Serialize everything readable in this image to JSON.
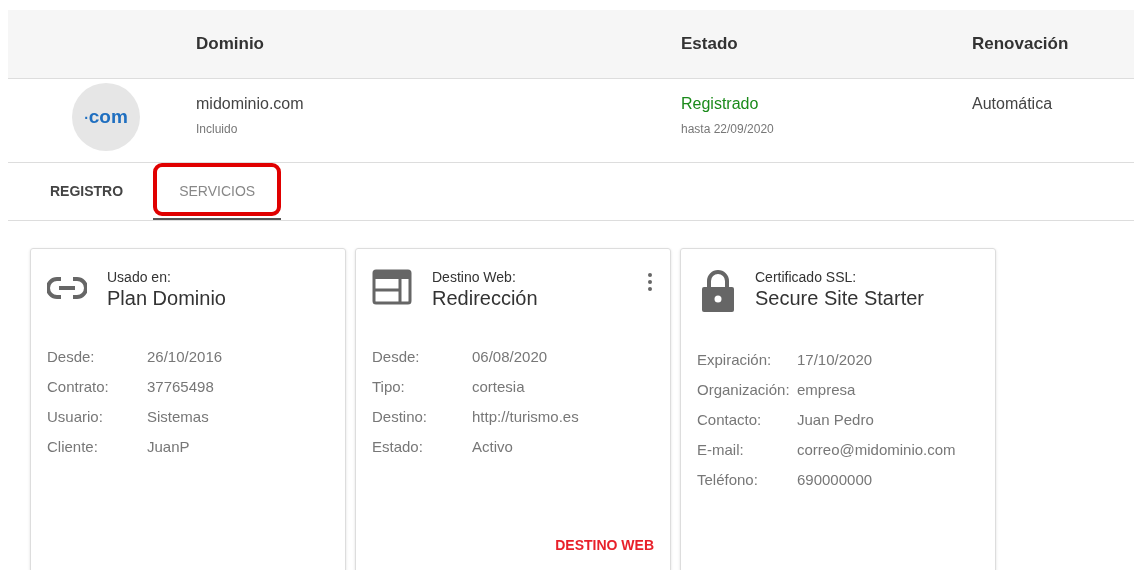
{
  "table": {
    "columns": [
      "Dominio",
      "Estado",
      "Renovación"
    ],
    "row": {
      "logo": "com",
      "logo_dot": "·",
      "domain": "midominio.com",
      "note": "Incluido",
      "status": "Registrado",
      "until": "hasta 22/09/2020",
      "renewal": "Automática"
    }
  },
  "tabs": [
    {
      "label": "REGISTRO",
      "selected": false
    },
    {
      "label": "SERVICIOS",
      "selected": true,
      "highlighted": true
    }
  ],
  "cards": [
    {
      "kind": "link",
      "caption": "Usado en:",
      "title": "Plan Dominio",
      "menu": false,
      "fields": [
        {
          "label": "Desde:",
          "value": "26/10/2016"
        },
        {
          "label": "Contrato:",
          "value": "37765498"
        },
        {
          "label": "Usuario:",
          "value": "Sistemas"
        },
        {
          "label": "Cliente:",
          "value": "JuanP"
        }
      ]
    },
    {
      "kind": "web",
      "caption": "Destino Web:",
      "title": "Redirección",
      "menu": true,
      "fields": [
        {
          "label": "Desde:",
          "value": "06/08/2020"
        },
        {
          "label": "Tipo:",
          "value": "cortesia"
        },
        {
          "label": "Destino:",
          "value": "http://turismo.es"
        },
        {
          "label": "Estado:",
          "value": "Activo"
        }
      ],
      "action": "DESTINO WEB"
    },
    {
      "kind": "lock",
      "caption": "Certificado SSL:",
      "title": "Secure Site Starter",
      "menu": false,
      "fields": [
        {
          "label": "Expiración:",
          "value": "17/10/2020"
        },
        {
          "label": "Organización:",
          "value": "empresa"
        },
        {
          "label": "Contacto:",
          "value": "Juan Pedro"
        },
        {
          "label": "E-mail:",
          "value": "correo@midominio.com"
        },
        {
          "label": "Teléfono:",
          "value": "690000000"
        }
      ]
    }
  ]
}
